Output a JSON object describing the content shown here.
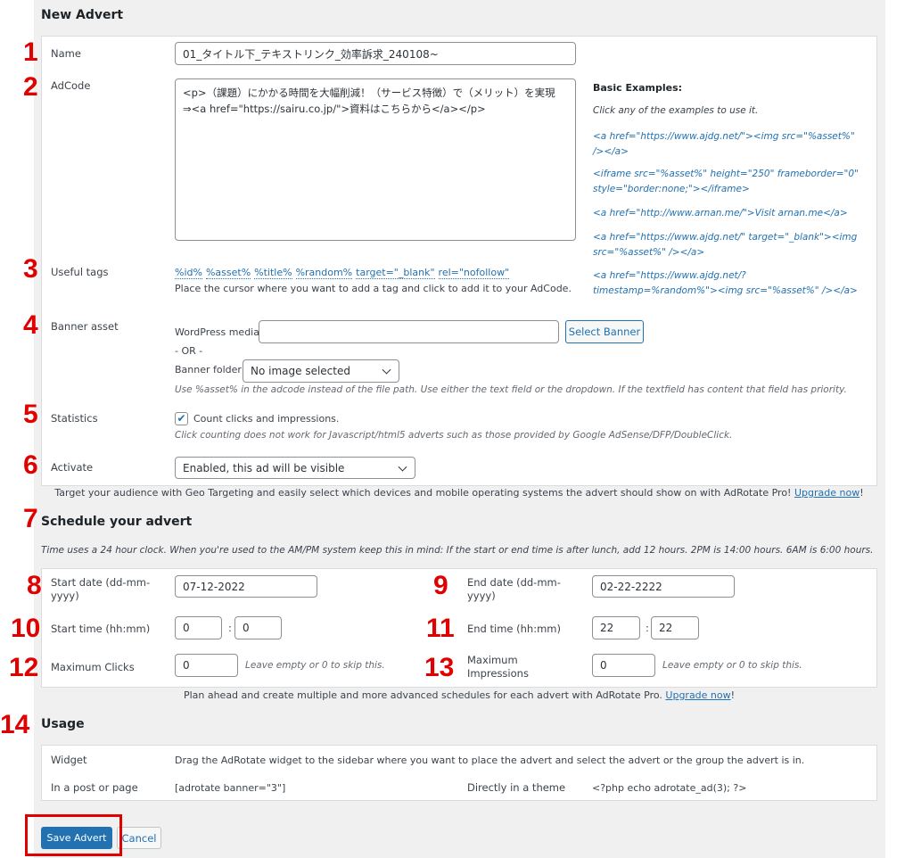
{
  "new_advert": {
    "title": "New Advert",
    "name_label": "Name",
    "name_value": "01_タイトル下_テキストリンク_効率訴求_240108~",
    "adcode_label": "AdCode",
    "adcode_value": "<p>（課題）にかかる時間を大幅削減！（サービス特徴）で（メリット）を実現⇒<a href=\"https://sairu.co.jp/\">資料はこちらから</a></p>",
    "examples_title": "Basic Examples:",
    "examples_hint": "Click any of the examples to use it.",
    "examples": [
      "<a href=\"https://www.ajdg.net/\"><img src=\"%asset%\" /></a>",
      "<iframe src=\"%asset%\" height=\"250\" frameborder=\"0\" style=\"border:none;\"></iframe>",
      "<a href=\"http://www.arnan.me/\">Visit arnan.me</a>",
      "<a href=\"https://www.ajdg.net/\" target=\"_blank\"><img src=\"%asset%\" /></a>",
      "<a href=\"https://www.ajdg.net/?timestamp=%random%\"><img src=\"%asset%\" /></a>"
    ],
    "tags_label": "Useful tags",
    "tags": [
      "%id%",
      "%asset%",
      "%title%",
      "%random%",
      "target=\"_blank\"",
      "rel=\"nofollow\""
    ],
    "tags_help": "Place the cursor where you want to add a tag and click to add it to your AdCode.",
    "banner_label": "Banner asset",
    "wp_media_label": "WordPress media:",
    "wp_media_value": "",
    "select_banner": "Select Banner",
    "or": "- OR -",
    "folder_label": "Banner folder:",
    "folder_value": "No image selected",
    "banner_help": "Use %asset% in the adcode instead of the file path. Use either the text field or the dropdown. If the textfield has content that field has priority.",
    "stats_label": "Statistics",
    "stats_checked": true,
    "stats_check_label": "Count clicks and impressions.",
    "stats_help": "Click counting does not work for Javascript/html5 adverts such as those provided by Google AdSense/DFP/DoubleClick.",
    "activate_label": "Activate",
    "activate_value": "Enabled, this ad will be visible",
    "promo": "Target your audience with Geo Targeting and easily select which devices and mobile operating systems the advert should show on with AdRotate Pro!",
    "upgrade": "Upgrade now",
    "promo_end": "!"
  },
  "schedule": {
    "title": "Schedule your advert",
    "help": "Time uses a 24 hour clock. When you're used to the AM/PM system keep this in mind: If the start or end time is after lunch, add 12 hours. 2PM is 14:00 hours. 6AM is 6:00 hours.",
    "start_date_label": "Start date (dd-mm-yyyy)",
    "start_date": "07-12-2022",
    "end_date_label": "End date (dd-mm-yyyy)",
    "end_date": "02-22-2222",
    "start_time_label": "Start time (hh:mm)",
    "start_h": "0",
    "start_m": "0",
    "end_time_label": "End time (hh:mm)",
    "end_h": "22",
    "end_m": "22",
    "colon": ":",
    "max_clicks_label": "Maximum Clicks",
    "max_clicks": "0",
    "max_impr_label": "Maximum Impressions",
    "max_impr": "0",
    "skip_note": "Leave empty or 0 to skip this.",
    "promo": "Plan ahead and create multiple and more advanced schedules for each advert with AdRotate Pro.",
    "upgrade": "Upgrade now",
    "promo_end": "!"
  },
  "usage": {
    "title": "Usage",
    "widget_label": "Widget",
    "widget_text": "Drag the AdRotate widget to the sidebar where you want to place the advert and select the advert or the group the advert is in.",
    "post_label": "In a post or page",
    "post_code": "[adrotate banner=\"3\"]",
    "theme_label": "Directly in a theme",
    "theme_code": "<?php echo adrotate_ad(3); ?>"
  },
  "actions": {
    "save": "Save Advert",
    "cancel": "Cancel"
  },
  "annotations": [
    "1",
    "2",
    "3",
    "4",
    "5",
    "6",
    "7",
    "8",
    "9",
    "10",
    "11",
    "12",
    "13",
    "14"
  ],
  "colors": {
    "annotation": "#e00000",
    "primary": "#2271b1"
  }
}
